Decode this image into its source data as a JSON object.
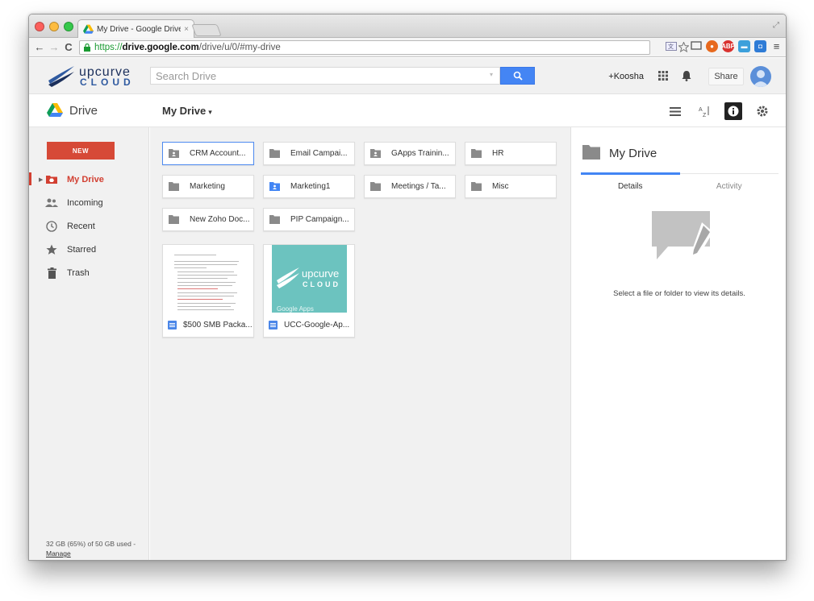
{
  "browser": {
    "tab_title": "My Drive - Google Drive",
    "tab_close": "×",
    "url_scheme": "https://",
    "url_host": "drive.google.com",
    "url_path": "/drive/u/0/#my-drive"
  },
  "header": {
    "logo_word1": "upcurve",
    "logo_word2": "CLOUD",
    "search_placeholder": "Search Drive",
    "account_name": "+Koosha",
    "share_label": "Share"
  },
  "subheader": {
    "app_title": "Drive",
    "breadcrumb": "My Drive",
    "breadcrumb_caret": "▾"
  },
  "sidebar": {
    "new_label": "NEW",
    "items": [
      {
        "label": "My Drive",
        "icon": "drive-folder-icon"
      },
      {
        "label": "Incoming",
        "icon": "people-icon"
      },
      {
        "label": "Recent",
        "icon": "clock-icon"
      },
      {
        "label": "Starred",
        "icon": "star-icon"
      },
      {
        "label": "Trash",
        "icon": "trash-icon"
      }
    ],
    "storage_text": "32 GB (65%) of 50 GB used -",
    "storage_manage": "Manage"
  },
  "folders": [
    {
      "name": "CRM Account...",
      "shared": true
    },
    {
      "name": "Email Campai...",
      "shared": false
    },
    {
      "name": "GApps Trainin...",
      "shared": true
    },
    {
      "name": "HR",
      "shared": false
    },
    {
      "name": "Marketing",
      "shared": false
    },
    {
      "name": "Marketing1",
      "shared": true
    },
    {
      "name": "Meetings / Ta...",
      "shared": false
    },
    {
      "name": "Misc",
      "shared": false
    },
    {
      "name": "New Zoho Doc...",
      "shared": false
    },
    {
      "name": "PIP Campaign...",
      "shared": false
    }
  ],
  "files": [
    {
      "name": "$500 SMB Packa..."
    },
    {
      "name": "UCC-Google-Ap...",
      "thumb_word1": "upcurve",
      "thumb_word2": "CLOUD",
      "thumb_footer": "Google Apps"
    }
  ],
  "details": {
    "title": "My Drive",
    "tab_details": "Details",
    "tab_activity": "Activity",
    "message": "Select a file or folder to view its details."
  },
  "colors": {
    "accent_blue": "#4285f4",
    "new_red": "#d64937",
    "active_red": "#d23f31",
    "teal": "#6cc3bf"
  }
}
